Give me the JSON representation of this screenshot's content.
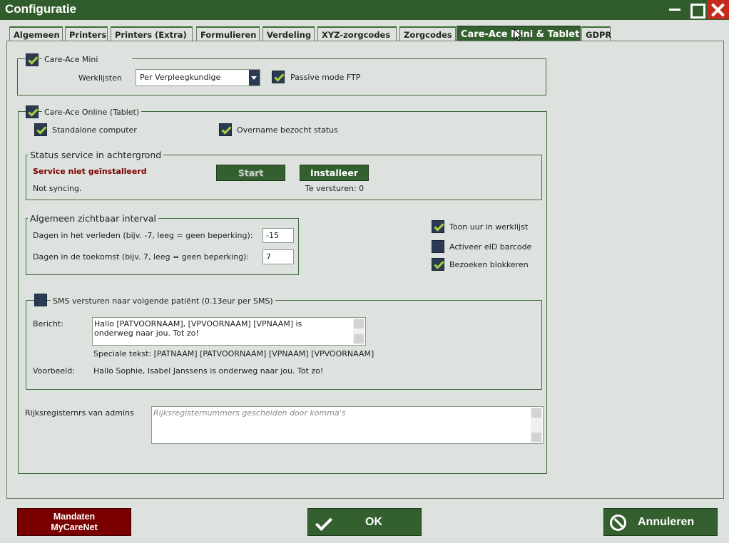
{
  "window": {
    "title": "Configuratie"
  },
  "tabs": [
    {
      "label": "Algemeen"
    },
    {
      "label": "Printers"
    },
    {
      "label": "Printers (Extra)"
    },
    {
      "label": "Formulieren"
    },
    {
      "label": "Verdeling"
    },
    {
      "label": "XYZ-zorgcodes"
    },
    {
      "label": "Zorgcodes"
    },
    {
      "label": "Care-Ace Mini & Tablet",
      "active": true
    },
    {
      "label": "GDPR"
    }
  ],
  "care_ace_mini": {
    "title": "Care-Ace Mini",
    "checked": true,
    "werklijsten_label": "Werklijsten",
    "werklijsten_value": "Per Verpleegkundige",
    "passive_ftp_label": "Passive mode FTP",
    "passive_ftp_checked": true
  },
  "care_ace_online": {
    "title": "Care-Ace Online (Tablet)",
    "checked": true,
    "standalone_label": "Standalone computer",
    "overname_label": "Overname bezocht status",
    "status_group": {
      "title": "Status service in achtergrond",
      "service_status": "Service niet geïnstalleerd",
      "start_button": "Start",
      "install_button": "Installeer",
      "sync_status": "Not syncing.",
      "te_versturen": "Te versturen: 0"
    },
    "interval_group": {
      "title": "Algemeen zichtbaar interval",
      "past_label": "Dagen in het verleden (bijv. -7, leeg = geen beperking):",
      "past_value": "-15",
      "future_label": "Dagen in de toekomst (bijv. 7, leeg = geen beperking):",
      "future_value": "7"
    },
    "toon_uur_label": "Toon uur in werklijst",
    "activeer_eid_label": "Activeer eID barcode",
    "bezoeken_blokkeren_label": "Bezoeken blokkeren",
    "sms_group": {
      "title": "SMS versturen naar volgende patiënt (0.13eur per SMS)",
      "bericht_label": "Bericht:",
      "bericht_value": "Hallo [PATVOORNAAM], [VPVOORNAAM] [VPNAAM] is\nonderweg naar jou. Tot zo!",
      "speciale_tekst": "Speciale tekst: [PATNAAM]  [PATVOORNAAM]  [VPNAAM]  [VPVOORNAAM]",
      "voorbeeld_label": "Voorbeeld:",
      "voorbeeld_value": "Hallo Sophie, Isabel Janssens is onderweg naar jou. Tot zo!"
    },
    "rijksregister_label": "Rijksregisternrs van admins",
    "rijksregister_placeholder": "Rijksregisternummers gescheiden door komma's"
  },
  "footer": {
    "mandaten_line1": "Mandaten",
    "mandaten_line2": "MyCareNet",
    "ok_label": "OK",
    "annuleren_label": "Annuleren"
  },
  "colors": {
    "accent_green": "#34602f",
    "check_green": "#a8d33c",
    "checkbox_bg": "#293a52",
    "danger_red": "#7a0000"
  }
}
